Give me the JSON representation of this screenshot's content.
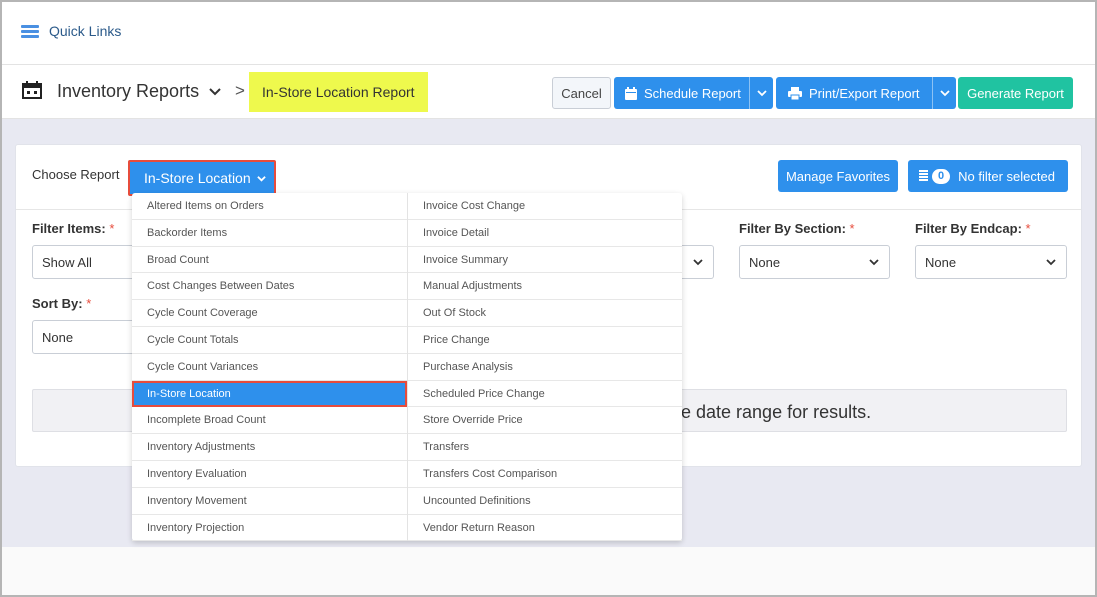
{
  "quicklinks": {
    "label": "Quick Links",
    "icon": "hamburger-icon"
  },
  "header": {
    "section_title": "Inventory Reports",
    "breadcrumb_separator": ">",
    "current_report": "In-Store Location Report"
  },
  "actions": {
    "cancel": "Cancel",
    "schedule": "Schedule Report",
    "print_export": "Print/Export Report",
    "generate": "Generate Report"
  },
  "choose": {
    "label": "Choose Report",
    "selected": "In-Store Location",
    "manage_favorites": "Manage Favorites",
    "filter_count": "0",
    "filter_text": "No filter selected"
  },
  "filters": {
    "filter_items_label": "Filter Items:",
    "filter_items_value": "Show All",
    "section_label": "Filter By Section:",
    "section_value": "None",
    "endcap_label": "Filter By Endcap:",
    "endcap_value": "None",
    "sort_label": "Sort By:",
    "sort_value": "None",
    "required_mark": "*"
  },
  "result_message": "e date range for results.",
  "dropdown": {
    "left": [
      "Altered Items on Orders",
      "Backorder Items",
      "Broad Count",
      "Cost Changes Between Dates",
      "Cycle Count Coverage",
      "Cycle Count Totals",
      "Cycle Count Variances",
      "In-Store Location",
      "Incomplete Broad Count",
      "Inventory Adjustments",
      "Inventory Evaluation",
      "Inventory Movement",
      "Inventory Projection"
    ],
    "right": [
      "Invoice Cost Change",
      "Invoice Detail",
      "Invoice Summary",
      "Manual Adjustments",
      "Out Of Stock",
      "Price Change",
      "Purchase Analysis",
      "Scheduled Price Change",
      "Store Override Price",
      "Transfers",
      "Transfers Cost Comparison",
      "Uncounted Definitions",
      "Vendor Return Reason"
    ],
    "active": "In-Store Location"
  },
  "colors": {
    "primary": "#2e90ec",
    "success": "#20c3a1",
    "highlight": "#eef94d",
    "danger": "#e74c3c"
  }
}
